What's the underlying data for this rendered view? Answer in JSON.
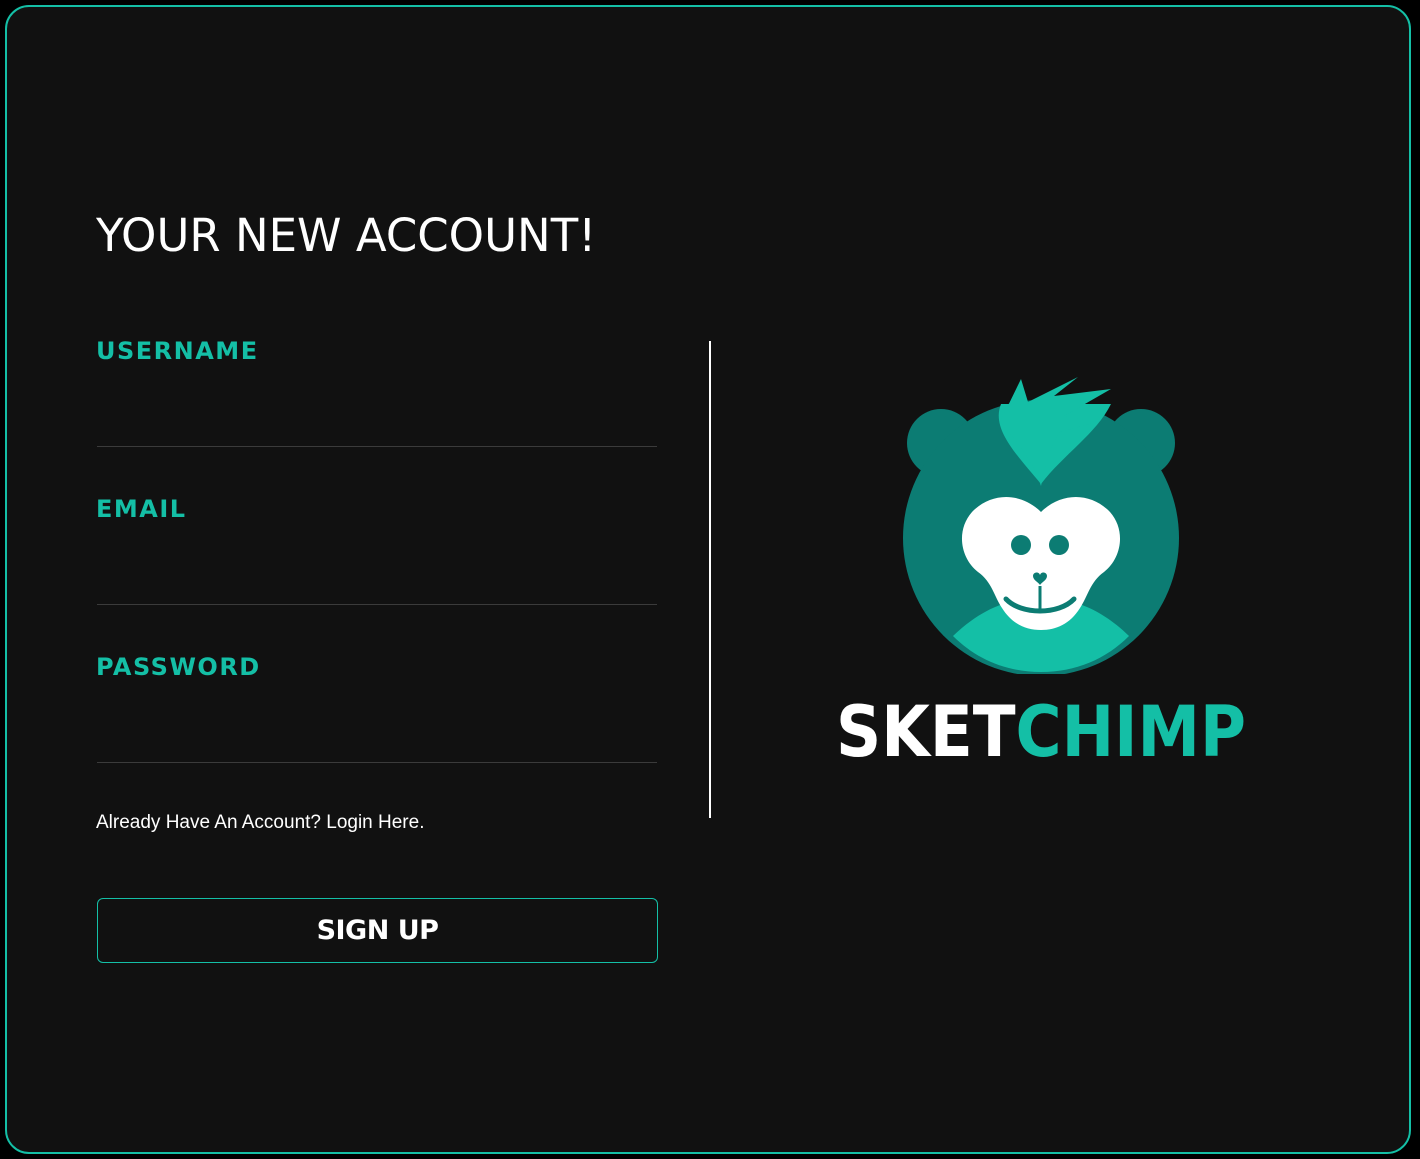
{
  "page": {
    "title": "YOUR NEW ACCOUNT!"
  },
  "form": {
    "username": {
      "label": "USERNAME",
      "value": "",
      "placeholder": ""
    },
    "email": {
      "label": "EMAIL",
      "value": "",
      "placeholder": ""
    },
    "password": {
      "label": "PASSWORD",
      "value": "",
      "placeholder": ""
    },
    "login_link": "Already Have An Account? Login Here.",
    "submit_label": "SIGN UP"
  },
  "brand": {
    "name_part1": "SKET",
    "name_part2": "CHIMP",
    "logo_icon": "chimp-head-icon"
  },
  "colors": {
    "accent": "#14bfa6",
    "accent_dark": "#0c7c73",
    "background": "#111111",
    "text": "#ffffff"
  }
}
